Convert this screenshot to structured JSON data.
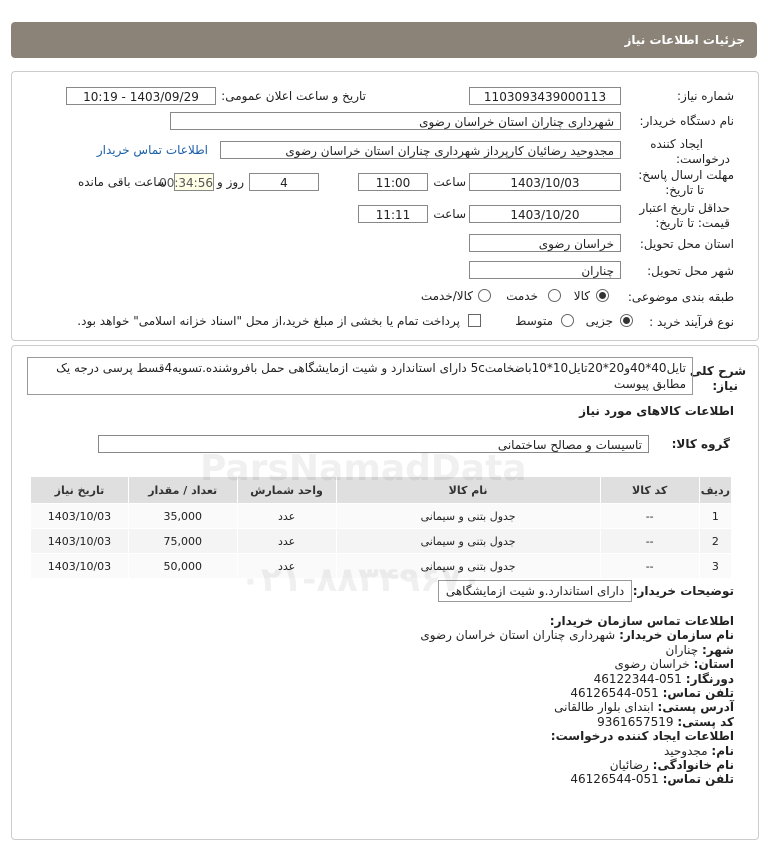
{
  "header": {
    "title": "جزئیات اطلاعات نیاز"
  },
  "fields": {
    "need_number_label": "شماره نیاز:",
    "need_number": "1103093439000113",
    "announce_label": "تاریخ و ساعت اعلان عمومی:",
    "announce_value": "1403/09/29 - 10:19",
    "buyer_org_label": "نام دستگاه خریدار:",
    "buyer_org": "شهرداری چناران استان خراسان رضوی",
    "creator_label1": "ایجاد کننده",
    "creator_label2": "درخواست:",
    "creator": "مجدوحید رضائیان کارپرداز شهرداری چناران استان خراسان رضوی",
    "buyer_contact_link": "اطلاعات تماس خریدار",
    "deadline_label1": "مهلت ارسال پاسخ:",
    "deadline_label2": "تا تاریخ:",
    "deadline_date": "1403/10/03",
    "time_label": "ساعت",
    "deadline_time": "11:00",
    "days": "4",
    "days_label": "روز و",
    "remaining_time": "00:34:56",
    "remaining_label": "ساعت باقی مانده",
    "validity_label1": "حداقل تاریخ اعتبار",
    "validity_label2": "قیمت: تا تاریخ:",
    "validity_date": "1403/10/20",
    "validity_time": "11:11",
    "province_label": "استان محل تحویل:",
    "province": "خراسان رضوی",
    "city_label": "شهر محل تحویل:",
    "city": "چناران",
    "category_label": "طبقه بندی موضوعی:",
    "category_options": [
      "کالا",
      "خدمت",
      "کالا/خدمت"
    ],
    "process_label": "نوع فرآیند خرید :",
    "process_options": [
      "جزیی",
      "متوسط"
    ],
    "payment_note": "پرداخت تمام یا بخشی از مبلغ خرید،از محل \"اسناد خزانه اسلامی\" خواهد بود."
  },
  "description": {
    "label1": "شرح کلی",
    "label2": "نیاز:",
    "text": "تایل40*40و20*20تایل10*10باضخامت5c دارای استاندارد و شیت ازمایشگاهی حمل بافروشنده.تسویه4قسط پرسی درجه یک مطابق پیوست"
  },
  "goods": {
    "section_title": "اطلاعات کالاهای مورد نیاز",
    "group_label": "گروه کالا:",
    "group_value": "تاسیسات و مصالح ساختمانی",
    "columns": [
      "ردیف",
      "کد کالا",
      "نام کالا",
      "واحد شمارش",
      "تعداد / مقدار",
      "تاریخ نیاز"
    ],
    "rows": [
      {
        "idx": "1",
        "code": "--",
        "name": "جدول بتنی و سیمانی",
        "unit": "عدد",
        "qty": "35,000",
        "date": "1403/10/03"
      },
      {
        "idx": "2",
        "code": "--",
        "name": "جدول بتنی و سیمانی",
        "unit": "عدد",
        "qty": "75,000",
        "date": "1403/10/03"
      },
      {
        "idx": "3",
        "code": "--",
        "name": "جدول بتنی و سیمانی",
        "unit": "عدد",
        "qty": "50,000",
        "date": "1403/10/03"
      }
    ]
  },
  "buyer_notes": {
    "label": "توضیحات خریدار:",
    "value": "دارای استاندارد.و شیت ازمایشگاهی"
  },
  "contact": {
    "title": "اطلاعات تماس سازمان خریدار:",
    "org_label": "نام سازمان خریدار:",
    "org": "شهرداری چناران استان خراسان رضوی",
    "city_label": "شهر:",
    "city": "چناران",
    "province_label": "استان:",
    "province": "خراسان رضوی",
    "fax_label": "دورنگار:",
    "fax": "051-46122344",
    "phone_label": "تلفن تماس:",
    "phone": "051-46126544",
    "address_label": "آدرس پستی:",
    "address": "ابتدای بلوار طالقانی",
    "postal_label": "کد پستی:",
    "postal": "9361657519",
    "creator_title": "اطلاعات ایجاد کننده درخواست:",
    "name_label": "نام:",
    "name": "مجدوحید",
    "family_label": "نام خانوادگی:",
    "family": "رضائیان",
    "creator_phone_label": "تلفن تماس:",
    "creator_phone": "051-46126544"
  },
  "watermark": {
    "brand": "ParsNamadData",
    "phone": "۰۲۱-۸۸۳۴۹۶۷۰"
  }
}
